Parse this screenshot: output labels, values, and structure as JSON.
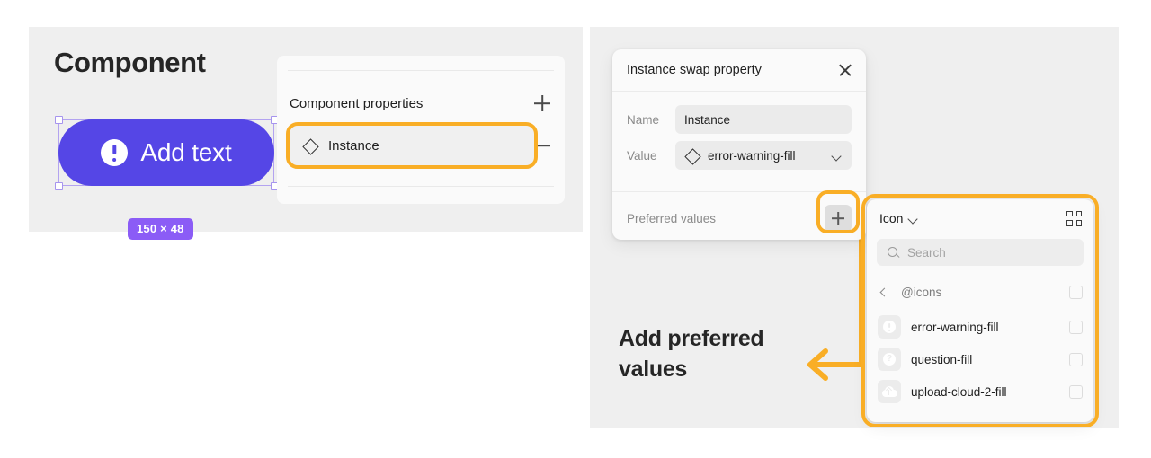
{
  "left_scene": {
    "title": "Component",
    "button": {
      "label": "Add text",
      "icon": "error-warning-fill-icon",
      "fill_color": "#5546e6",
      "text_color": "#ffffff"
    },
    "size_badge": {
      "text": "150 × 48",
      "color": "#8b5cf6"
    },
    "properties_panel": {
      "header": "Component properties",
      "add_label": "+",
      "rows": [
        {
          "icon": "diamond-icon",
          "label": "Instance",
          "remove_label": "−",
          "highlighted": true
        }
      ]
    }
  },
  "right_scene": {
    "dialog": {
      "title": "Instance swap property",
      "close_icon": "close-icon",
      "fields": [
        {
          "label": "Name",
          "value": "Instance",
          "has_icon": false,
          "has_chevron": false
        },
        {
          "label": "Value",
          "value": "error-warning-fill",
          "has_icon": true,
          "has_chevron": true
        }
      ],
      "preferred_values": {
        "label": "Preferred values",
        "add_button_label": "+",
        "highlighted": true
      }
    },
    "annotation": {
      "text": "Add preferred values",
      "arrow_color": "#f9ae26"
    },
    "icon_picker": {
      "title": "Icon",
      "title_chevron": "chevron-down-icon",
      "grid_view_icon": "grid-view-icon",
      "search_placeholder": "Search",
      "search_value": "",
      "breadcrumb": {
        "back_icon": "chevron-left-icon",
        "name": "@icons",
        "checked": false
      },
      "items": [
        {
          "name": "error-warning-fill",
          "icon": "error-warning-fill-icon",
          "checked": false
        },
        {
          "name": "question-fill",
          "icon": "question-fill-icon",
          "checked": false
        },
        {
          "name": "upload-cloud-2-fill",
          "icon": "upload-cloud-2-fill-icon",
          "checked": false
        }
      ]
    }
  },
  "theme": {
    "highlight_color": "#f9ae26",
    "canvas_color": "#efefef",
    "panel_color": "#fafafa"
  }
}
